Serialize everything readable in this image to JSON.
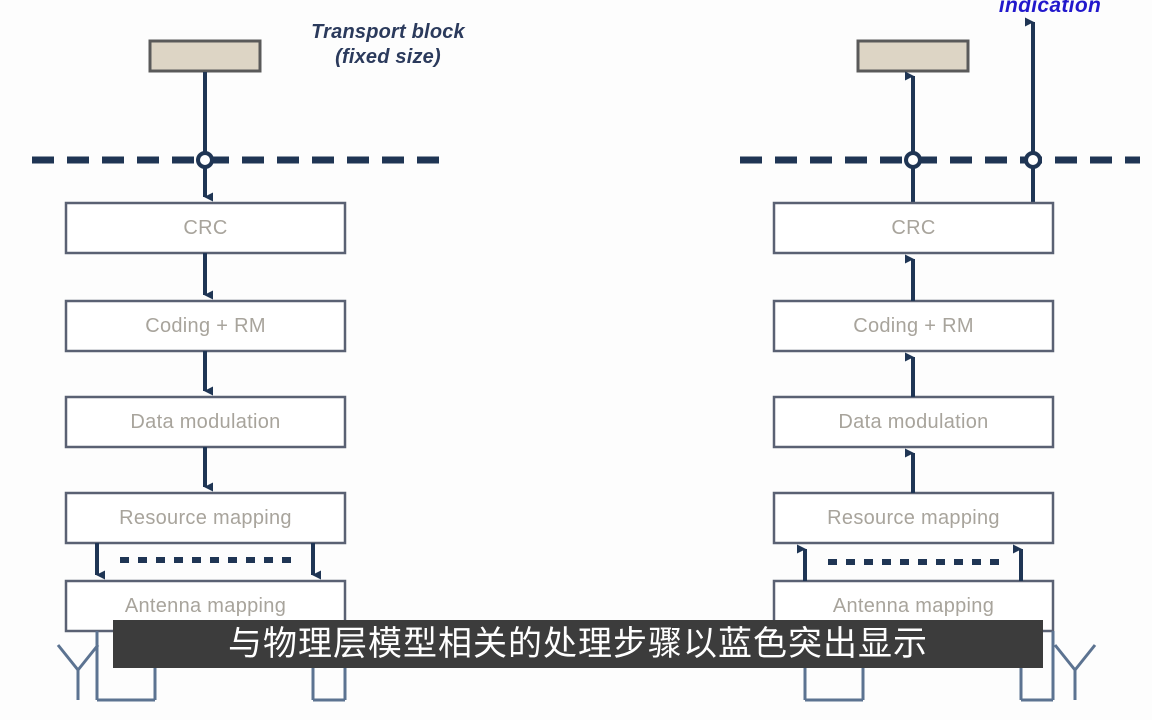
{
  "diagram": {
    "title_annotation": "Transport block\n(fixed size)",
    "indication_label": "indication",
    "subtitle": "与物理层模型相关的处理步骤以蓝色突出显示",
    "colors": {
      "background": "#fdfdfd",
      "box_fill": "#ffffff",
      "box_border": "#5a6173",
      "box_text": "#a8a49c",
      "arrow": "#1f3554",
      "transport_block_fill": "#ddd5c5",
      "transport_block_border": "#5a5a5a",
      "annotation_text": "#2b3a5c",
      "indication_text": "#2218cc",
      "subtitle_band": "#3c3c3c",
      "subtitle_text": "#ffffff",
      "antenna": "#5c7391"
    },
    "chains": [
      {
        "name": "transmitter",
        "direction": "downward",
        "side": "left",
        "has_transport_block": true,
        "has_indication": false,
        "steps": [
          {
            "label": "CRC"
          },
          {
            "label": "Coding + RM"
          },
          {
            "label": "Data modulation"
          },
          {
            "label": "Resource mapping"
          },
          {
            "label": "Antenna mapping"
          }
        ],
        "antenna_count": 2
      },
      {
        "name": "receiver",
        "direction": "upward",
        "side": "right",
        "has_transport_block": true,
        "has_indication": true,
        "steps": [
          {
            "label": "CRC"
          },
          {
            "label": "Coding + RM"
          },
          {
            "label": "Data modulation"
          },
          {
            "label": "Resource mapping"
          },
          {
            "label": "Antenna mapping"
          }
        ],
        "antenna_count": 2
      }
    ],
    "boundary": {
      "style": "dashed",
      "description": "physical layer boundary"
    }
  }
}
